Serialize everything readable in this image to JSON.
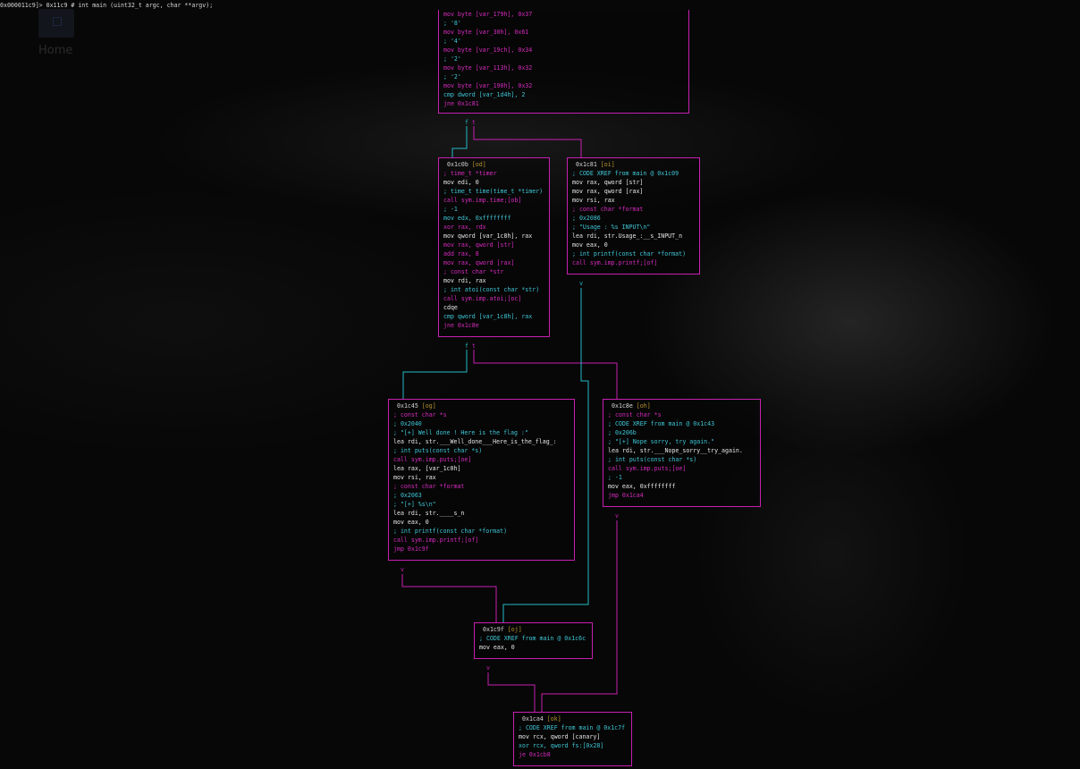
{
  "prompt": "0x000011c9]> 0x11c9 # int main (uint32_t argc, char **argv);",
  "desktop": {
    "label": "Home"
  },
  "nodes": [
    {
      "id": "top",
      "lines": [
        {
          "t": "mov byte [var_179h], 0x37",
          "c": "m"
        },
        {
          "t": "; '8'",
          "c": "c"
        },
        {
          "t": "mov byte [var_30h], 0x61",
          "c": "m"
        },
        {
          "t": "; '4'",
          "c": "c"
        },
        {
          "t": "mov byte [var_19ch], 0x34",
          "c": "m"
        },
        {
          "t": "; '2'",
          "c": "c"
        },
        {
          "t": "mov byte [var_113h], 0x32",
          "c": "m"
        },
        {
          "t": "; '2'",
          "c": "c"
        },
        {
          "t": "mov byte [var_190h], 0x32",
          "c": "m"
        },
        {
          "t": "cmp dword [var_1d4h], 2",
          "c": "c"
        },
        {
          "t": "jne 0x1c81",
          "c": "m"
        }
      ]
    },
    {
      "id": "od",
      "addr": "0x1c0b",
      "tag": "[od]",
      "lines": [
        {
          "t": "; time_t *timer",
          "c": "m"
        },
        {
          "t": "mov edi, 0",
          "c": "w"
        },
        {
          "t": "; time_t time(time_t *timer)",
          "c": "c"
        },
        {
          "t": "call sym.imp.time;[ob]",
          "c": "m"
        },
        {
          "t": "; -1",
          "c": "c"
        },
        {
          "t": "mov edx, 0xffffffff",
          "c": "c"
        },
        {
          "t": "xor rax, rdx",
          "c": "m"
        },
        {
          "t": "mov qword [var_1c8h], rax",
          "c": "w"
        },
        {
          "t": "mov rax, qword [str]",
          "c": "m"
        },
        {
          "t": "add rax, 8",
          "c": "m"
        },
        {
          "t": "mov rax, qword [rax]",
          "c": "m"
        },
        {
          "t": "; const char *str",
          "c": "m"
        },
        {
          "t": "mov rdi, rax",
          "c": "w"
        },
        {
          "t": "; int atoi(const char *str)",
          "c": "c"
        },
        {
          "t": "call sym.imp.atoi;[oc]",
          "c": "m"
        },
        {
          "t": "cdqe",
          "c": "w"
        },
        {
          "t": "cmp qword [var_1c8h], rax",
          "c": "c"
        },
        {
          "t": "jne 0x1c8e",
          "c": "m"
        }
      ]
    },
    {
      "id": "oi",
      "addr": "0x1c81",
      "tag": "[oi]",
      "lines": [
        {
          "t": "; CODE XREF from main @ 0x1c09",
          "c": "c"
        },
        {
          "t": "mov rax, qword [str]",
          "c": "w"
        },
        {
          "t": "mov rax, qword [rax]",
          "c": "w"
        },
        {
          "t": "mov rsi, rax",
          "c": "w"
        },
        {
          "t": "; const char *format",
          "c": "m"
        },
        {
          "t": "; 0x2086",
          "c": "c"
        },
        {
          "t": "; \"Usage : %s INPUT\\n\"",
          "c": "c"
        },
        {
          "t": "lea rdi, str.Usage_:__s_INPUT_n",
          "c": "w"
        },
        {
          "t": "mov eax, 0",
          "c": "w"
        },
        {
          "t": "; int printf(const char *format)",
          "c": "c"
        },
        {
          "t": "call sym.imp.printf;[of]",
          "c": "m"
        }
      ]
    },
    {
      "id": "og",
      "addr": "0x1c45",
      "tag": "[og]",
      "lines": [
        {
          "t": "; const char *s",
          "c": "m"
        },
        {
          "t": "; 0x2040",
          "c": "c"
        },
        {
          "t": "; \"[+] Well done ! Here is the flag :\"",
          "c": "c"
        },
        {
          "t": "lea rdi, str.___Well_done___Here_is_the_flag_:",
          "c": "w"
        },
        {
          "t": "; int puts(const char *s)",
          "c": "c"
        },
        {
          "t": "call sym.imp.puts;[oe]",
          "c": "m"
        },
        {
          "t": "lea rax, [var_1c0h]",
          "c": "w"
        },
        {
          "t": "mov rsi, rax",
          "c": "w"
        },
        {
          "t": "; const char *format",
          "c": "m"
        },
        {
          "t": "; 0x2063",
          "c": "c"
        },
        {
          "t": "; \"[+] %s\\n\"",
          "c": "c"
        },
        {
          "t": "lea rdi, str.____s_n",
          "c": "w"
        },
        {
          "t": "mov eax, 0",
          "c": "w"
        },
        {
          "t": "; int printf(const char *format)",
          "c": "c"
        },
        {
          "t": "call sym.imp.printf;[of]",
          "c": "m"
        },
        {
          "t": "jmp 0x1c9f",
          "c": "m"
        }
      ]
    },
    {
      "id": "oh",
      "addr": "0x1c8e",
      "tag": "[oh]",
      "lines": [
        {
          "t": "; const char *s",
          "c": "m"
        },
        {
          "t": "; CODE XREF from main @ 0x1c43",
          "c": "c"
        },
        {
          "t": "; 0x206b",
          "c": "c"
        },
        {
          "t": "; \"[+] Nope sorry, try again.\"",
          "c": "c"
        },
        {
          "t": "lea rdi, str.___Nope_sorry__try_again.",
          "c": "w"
        },
        {
          "t": "; int puts(const char *s)",
          "c": "c"
        },
        {
          "t": "call sym.imp.puts;[oe]",
          "c": "m"
        },
        {
          "t": "; -1",
          "c": "c"
        },
        {
          "t": "mov eax, 0xffffffff",
          "c": "w"
        },
        {
          "t": "jmp 0x1ca4",
          "c": "m"
        }
      ]
    },
    {
      "id": "oj",
      "addr": "0x1c9f",
      "tag": "[oj]",
      "lines": [
        {
          "t": "; CODE XREF from main @ 0x1c6c",
          "c": "c"
        },
        {
          "t": "mov eax, 0",
          "c": "w"
        }
      ]
    },
    {
      "id": "ok",
      "addr": "0x1ca4",
      "tag": "[ok]",
      "lines": [
        {
          "t": "; CODE XREF from main @ 0x1c7f",
          "c": "c"
        },
        {
          "t": "mov rcx, qword [canary]",
          "c": "w"
        },
        {
          "t": "xor rcx, qword fs:[0x28]",
          "c": "c"
        },
        {
          "t": "je 0x1cb8",
          "c": "m"
        }
      ]
    }
  ],
  "arrows": {
    "t1_f": "f",
    "t1_t": "t",
    "t2_f": "f",
    "t2_t": "t",
    "v_oi": "v",
    "v_og": "v",
    "v_oh": "v",
    "v_oj": "v"
  },
  "colors": {
    "border": "#c71fb0",
    "cyan": "#3fc6d6",
    "magenta": "#d52bbd",
    "white": "#e6e6e6",
    "tag": "#b8932e"
  }
}
